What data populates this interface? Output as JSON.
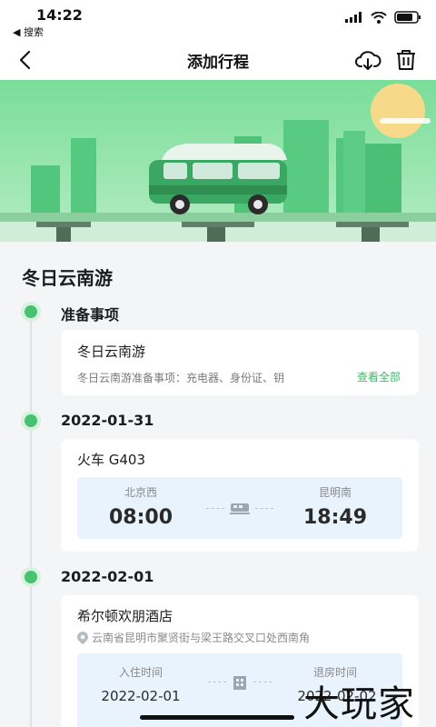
{
  "status_bar": {
    "time": "14:22",
    "back_app": "◀ 搜索"
  },
  "nav": {
    "title": "添加行程"
  },
  "trip": {
    "title": "冬日云南游"
  },
  "sections": {
    "prep": {
      "label": "准备事项",
      "card_title": "冬日云南游",
      "card_desc": "冬日云南游准备事项：充电器、身份证、钥",
      "view_all": "查看全部"
    },
    "day1": {
      "date": "2022-01-31",
      "train_title": "火车 G403",
      "from_station": "北京西",
      "to_station": "昆明南",
      "depart_time": "08:00",
      "arrive_time": "18:49"
    },
    "day2": {
      "date": "2022-02-01",
      "hotel_name": "希尔顿欢朋酒店",
      "address": "云南省昆明市聚贤街与梁王路交叉口处西南角",
      "checkin_label": "入住时间",
      "checkout_label": "退房时间",
      "checkin_date": "2022-02-01",
      "checkout_date": "2022-02-02"
    }
  },
  "watermark": "大玩家",
  "colors": {
    "accent": "#48c270",
    "banner": "#79dd97",
    "info_box": "#e8f3fd"
  }
}
